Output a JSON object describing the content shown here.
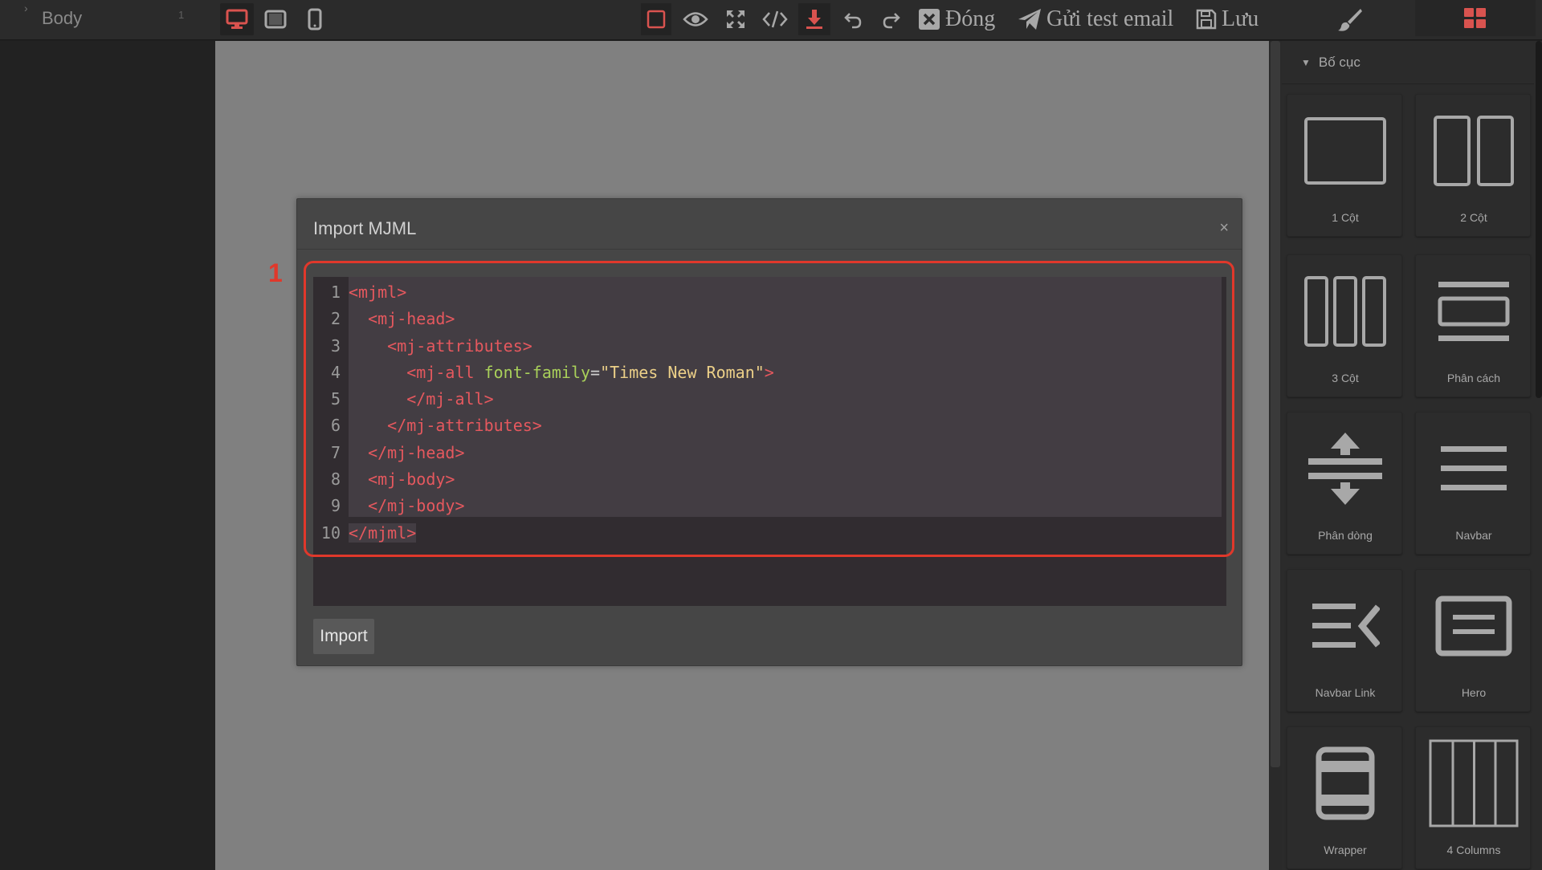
{
  "layer_manager": {
    "layer_name": "Body",
    "layer_count": "1"
  },
  "toolbar": {
    "close_label": "Đóng",
    "send_test_label": "Gửi test email",
    "save_label": "Lưu"
  },
  "modal": {
    "title": "Import MJML",
    "close": "×",
    "import_label": "Import",
    "code_lines": [
      {
        "n": "1"
      },
      {
        "n": "2"
      },
      {
        "n": "3"
      },
      {
        "n": "4",
        "open": "<mj-all ",
        "attr": "font-family",
        "eq": "=",
        "str": "\"Times New Roman\"",
        "close": ">"
      },
      {
        "n": "5"
      },
      {
        "n": "6"
      },
      {
        "n": "7"
      },
      {
        "n": "8"
      },
      {
        "n": "9"
      },
      {
        "n": "10"
      }
    ],
    "code_text": {
      "l1": "<mjml>",
      "l2": "<mj-head>",
      "l3": "<mj-attributes>",
      "l5": "</mj-all>",
      "l6": "</mj-attributes>",
      "l7": "</mj-head>",
      "l8": "<mj-body>",
      "l9": "</mj-body>",
      "l10": "</mjml>"
    }
  },
  "annotation": {
    "number": "1",
    "color": "#e0382b"
  },
  "blocks_panel": {
    "category": "Bố cục",
    "blocks": [
      {
        "label": "1 Cột",
        "icon": "one-column-icon"
      },
      {
        "label": "2 Cột",
        "icon": "two-columns-icon"
      },
      {
        "label": "3 Cột",
        "icon": "three-columns-icon"
      },
      {
        "label": "Phân cách",
        "icon": "divider-icon"
      },
      {
        "label": "Phân dòng",
        "icon": "spacer-icon"
      },
      {
        "label": "Navbar",
        "icon": "navbar-icon"
      },
      {
        "label": "Navbar Link",
        "icon": "navbar-link-icon"
      },
      {
        "label": "Hero",
        "icon": "hero-icon"
      },
      {
        "label": "Wrapper",
        "icon": "wrapper-icon"
      },
      {
        "label": "4 Columns",
        "icon": "four-columns-icon"
      }
    ]
  },
  "colors": {
    "accent": "#d9534f",
    "code_tag": "#e5585e",
    "code_attr": "#a9d05a",
    "code_string": "#ecd088"
  }
}
